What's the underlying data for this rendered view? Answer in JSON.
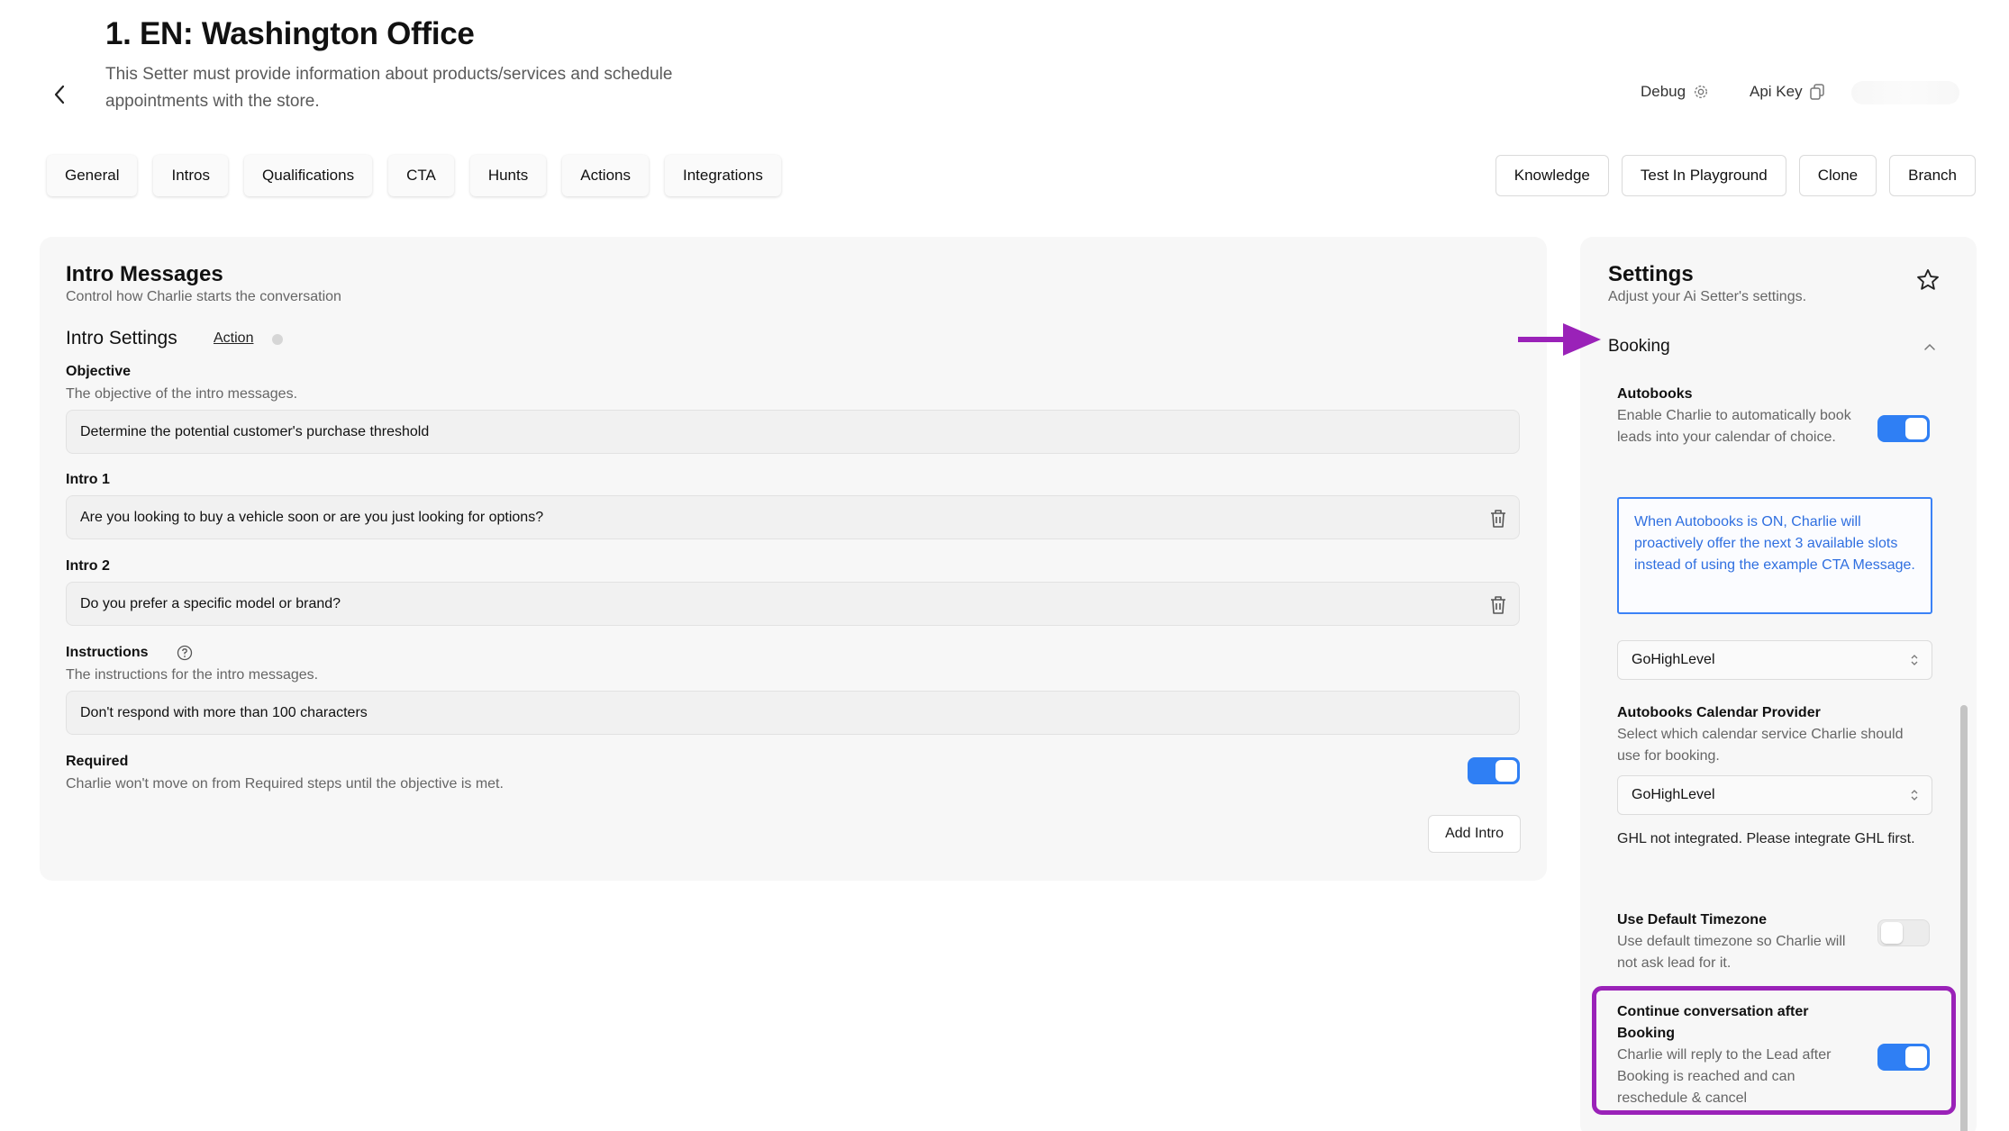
{
  "header": {
    "title": "1. EN: Washington Office",
    "description": "This Setter must provide information about products/services and schedule appointments with the store.",
    "debug_label": "Debug",
    "api_key_label": "Api Key"
  },
  "tabs": [
    "General",
    "Intros",
    "Qualifications",
    "CTA",
    "Hunts",
    "Actions",
    "Integrations"
  ],
  "toolbar": [
    "Knowledge",
    "Test In Playground",
    "Clone",
    "Branch"
  ],
  "intro_panel": {
    "title": "Intro Messages",
    "subtitle": "Control how Charlie starts the conversation",
    "settings_title": "Intro Settings",
    "action_link": "Action",
    "objective_label": "Objective",
    "objective_hint": "The objective of the intro messages.",
    "objective_value": "Determine the potential customer's purchase threshold",
    "intro1_label": "Intro 1",
    "intro1_value": "Are you looking to buy a vehicle soon or are you just looking for options?",
    "intro2_label": "Intro 2",
    "intro2_value": "Do you prefer a specific model or brand?",
    "instructions_label": "Instructions",
    "instructions_hint": "The instructions for the intro messages.",
    "instructions_value": "Don't respond with more than 100 characters",
    "required_label": "Required",
    "required_hint": "Charlie won't move on from Required steps until the objective is met.",
    "required_on": true,
    "add_intro_label": "Add Intro"
  },
  "settings_panel": {
    "title": "Settings",
    "subtitle": "Adjust your Ai Setter's settings.",
    "booking_label": "Booking",
    "autobooks_label": "Autobooks",
    "autobooks_hint": "Enable Charlie to automatically book leads into your calendar of choice.",
    "autobooks_on": true,
    "info_text": "When Autobooks is ON, Charlie will proactively offer the next 3 available slots instead of using the example CTA Message.",
    "select1_value": "GoHighLevel",
    "provider_label": "Autobooks Calendar Provider",
    "provider_hint": "Select which calendar service Charlie should use for booking.",
    "provider_value": "GoHighLevel",
    "ghl_note": "GHL not integrated. Please integrate GHL first.",
    "timezone_label": "Use Default Timezone",
    "timezone_hint": "Use default timezone so Charlie will not ask lead for it.",
    "timezone_on": false,
    "continue_label": "Continue conversation after Booking",
    "continue_hint": "Charlie will reply to the Lead after Booking is reached and can reschedule & cancel",
    "continue_on": true
  },
  "colors": {
    "accent": "#2f7ff4",
    "annotation": "#9a22b8",
    "info_text": "#2f6fe0"
  },
  "icons": [
    "chevron-left-icon",
    "gear-icon",
    "copy-icon",
    "trash-icon",
    "help-circle-icon",
    "star-icon",
    "chevron-up-icon",
    "updown-chevron-icon",
    "arrow-annotation"
  ]
}
